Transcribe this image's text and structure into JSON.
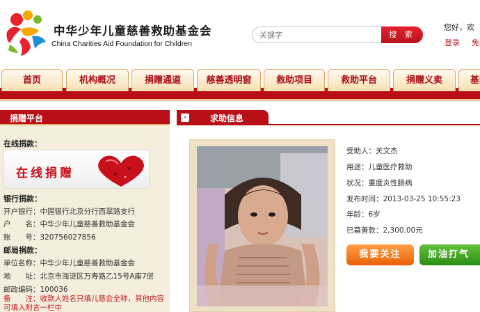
{
  "header": {
    "org_name_cn": "中华少年儿童慈善救助基金会",
    "org_name_en": "China Charities Aid Foundation for Children",
    "search_placeholder": "关键字",
    "search_button": "搜 索",
    "greeting": "您好，欢",
    "login": "登录",
    "register": "免"
  },
  "nav": {
    "tabs": [
      "首页",
      "机构概况",
      "捐赠通道",
      "慈善透明窗",
      "救助项目",
      "救助平台",
      "捐赠义卖",
      "基金"
    ]
  },
  "sidebar": {
    "title": "捐赠平台",
    "online_label": "在线捐款：",
    "online_button": "在线捐赠",
    "bank_label": "银行捐款：",
    "bank_rows": [
      "开户银行：中国银行北京分行西翠路支行",
      "户　　名：中华少年儿童慈善救助基金会",
      "账　　号：320756027856"
    ],
    "post_label": "邮局捐款：",
    "post_rows": [
      "单位名称：中华少年儿童慈善救助基金会",
      "地　　址：北京市海淀区万寿路乙15号A座7层",
      "邮政编码：100036"
    ],
    "note": "备　　注：收款人姓名只填儿慈会全称，其他内容可填入附言一栏中"
  },
  "main": {
    "title": "求助信息",
    "recipient": "受助人：关文杰",
    "purpose": "用途：儿童医疗救助",
    "condition": "状况：重度炎性肠病",
    "published": "发布时间：2013-03-25 10:55:23",
    "age": "年龄：6岁",
    "raised": "已募善款：2,300.00元",
    "follow_button": "我要关注",
    "cheer_button": "加油打气"
  },
  "colors": {
    "brand_red": "#b80f16",
    "tab_bg": "#f6dfb2",
    "sidebar_bg": "#f6eedc",
    "follow_orange": "#ea5f06",
    "cheer_green": "#2c8e14"
  }
}
